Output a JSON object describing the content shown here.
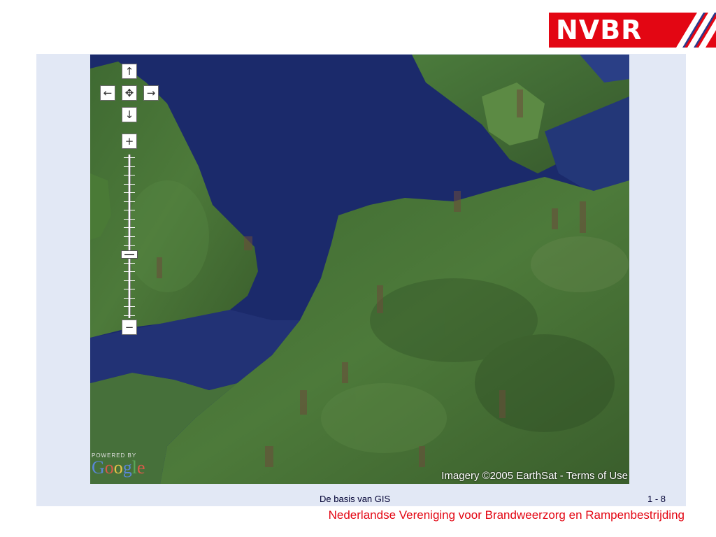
{
  "logo": {
    "text": "NVBR"
  },
  "map": {
    "controls": {
      "pan_up": "↑",
      "pan_left": "←",
      "pan_center": "✥",
      "pan_right": "→",
      "pan_down": "↓",
      "zoom_in": "+",
      "zoom_out": "−"
    },
    "zoom_level": 0.62,
    "powered_by": "POWERED BY",
    "google_letters": [
      "G",
      "o",
      "o",
      "g",
      "l",
      "e"
    ],
    "attribution": "Imagery ©2005 EarthSat",
    "attribution_sep": " - ",
    "terms": "Terms of Use"
  },
  "footer": {
    "title": "De basis van GIS",
    "page": "1 - 8",
    "organization": "Nederlandse Vereniging voor Brandweerzorg en Rampenbestrijding"
  },
  "colors": {
    "brand_red": "#e30613",
    "panel_bg": "#e2e8f5",
    "sea": "#1b2a6b"
  }
}
